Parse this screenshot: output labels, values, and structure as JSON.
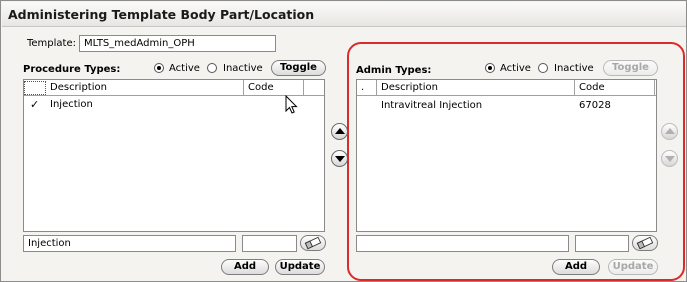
{
  "window": {
    "title": "Administering Template Body Part/Location"
  },
  "template": {
    "label": "Template:",
    "value": "MLTS_medAdmin_OPH"
  },
  "procedure": {
    "heading": "Procedure Types:",
    "filter": {
      "active_label": "Active",
      "inactive_label": "Inactive",
      "selected": "Active"
    },
    "toggle_label": "Toggle",
    "columns": {
      "marker": "",
      "description": "Description",
      "code": "Code"
    },
    "rows": [
      {
        "checked": "✓",
        "description": "Injection",
        "code": ""
      }
    ],
    "description_input": "Injection",
    "code_input": "",
    "add_label": "Add",
    "update_label": "Update"
  },
  "admin": {
    "heading": "Admin Types:",
    "filter": {
      "active_label": "Active",
      "inactive_label": "Inactive",
      "selected": "Active"
    },
    "toggle_label": "Toggle",
    "toggle_enabled": false,
    "columns": {
      "marker": ".",
      "description": "Description",
      "code": "Code"
    },
    "rows": [
      {
        "checked": "",
        "description": "Intravitreal Injection",
        "code": "67028"
      }
    ],
    "description_input": "",
    "code_input": "",
    "add_label": "Add",
    "update_label": "Update",
    "update_enabled": false
  },
  "icons": {
    "move_up": "triangle-up",
    "move_down": "triangle-down",
    "clear": "eraser",
    "checkmark": "checkmark",
    "cursor": "mouse-pointer"
  },
  "colors": {
    "highlight": "#d92b2b",
    "disabled_text": "#a8a8a8"
  }
}
